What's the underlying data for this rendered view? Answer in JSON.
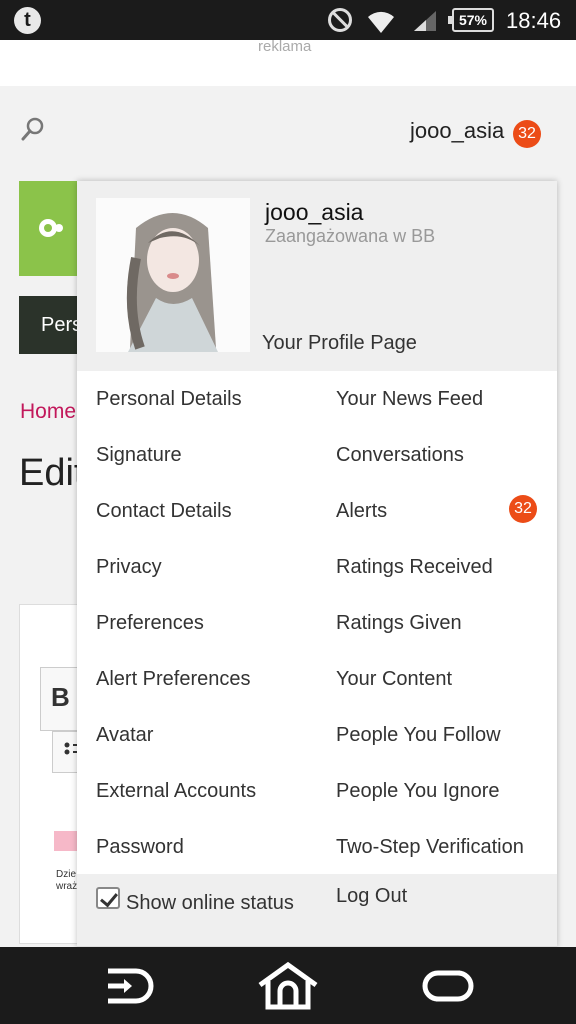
{
  "status_bar": {
    "app_icon": "tumblr-icon",
    "icons": [
      "do-not-disturb-icon",
      "wifi-icon",
      "signal-icon"
    ],
    "battery": "57%",
    "time": "18:46"
  },
  "page": {
    "ad_label": "reklama",
    "user_link": "jooo_asia",
    "alerts_count": "32",
    "dark_tab": "Pers",
    "breadcrumb": "Home",
    "title": "Edit",
    "editor_bold": "B",
    "editor_snippet": "Dzie\nwraż"
  },
  "menu": {
    "username": "jooo_asia",
    "user_title": "Zaangażowana w BB",
    "profile_link": "Your Profile Page",
    "left_items": [
      "Personal Details",
      "Signature",
      "Contact Details",
      "Privacy",
      "Preferences",
      "Alert Preferences",
      "Avatar",
      "External Accounts",
      "Password"
    ],
    "right_items": [
      "Your News Feed",
      "Conversations",
      "Alerts",
      "Ratings Received",
      "Ratings Given",
      "Your Content",
      "People You Follow",
      "People You Ignore",
      "Two-Step Verification"
    ],
    "alerts_badge": "32",
    "show_online_status": "Show online status",
    "show_online_checked": true,
    "log_out": "Log Out"
  },
  "colors": {
    "badge": "#ec4c17",
    "breadcrumb": "#c2185b",
    "logo_green": "#8bc34a",
    "status_bar": "#1b1b1b"
  }
}
